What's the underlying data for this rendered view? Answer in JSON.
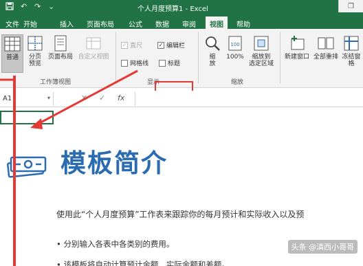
{
  "window": {
    "title": "个人月度预算1 - Excel",
    "restore_glyph": "❐"
  },
  "quick_access": {
    "undo_glyph": "↶",
    "redo_glyph": "↷",
    "more_glyph": "⌄"
  },
  "menu_tabs": [
    {
      "label": "文件"
    },
    {
      "label": "开始"
    },
    {
      "label": "插入"
    },
    {
      "label": "页面布局"
    },
    {
      "label": "公式"
    },
    {
      "label": "数据"
    },
    {
      "label": "审阅"
    },
    {
      "label": "视图"
    },
    {
      "label": "帮助"
    }
  ],
  "active_tab": "视图",
  "ribbon": {
    "workbook_views": {
      "group_label": "工作簿视图",
      "normal": "普通",
      "page_break": "分页\n预览",
      "page_layout": "页面布局",
      "custom_view": "自定义视图"
    },
    "show": {
      "group_label": "显示",
      "ruler": {
        "label": "直尺",
        "checked": true
      },
      "formula_bar": {
        "label": "编辑栏",
        "checked": true
      },
      "gridlines": {
        "label": "网格线",
        "checked": false
      },
      "headings": {
        "label": "标题",
        "checked": false
      }
    },
    "zoom": {
      "group_label": "缩放",
      "zoom": "缩\n放",
      "hundred": "100%",
      "zoom_to_selection": "缩放到\n选定区域"
    },
    "window": {
      "new_window": "新建窗口",
      "arrange_all": "全部重排",
      "freeze": "冻结窗\n格"
    }
  },
  "formula_bar": {
    "name_box": "A1",
    "cancel_glyph": "✕",
    "enter_glyph": "✓",
    "fx": "fx",
    "content": ""
  },
  "sheet": {
    "heading": "模板简介",
    "intro": "使用此“个人月度预算”工作表来跟踪你的每月预计和实际收入以及预",
    "bullets": [
      "• 分别输入各表中各类别的费用。",
      "• 该模板将自动计算预计金额、实际金额和差额。"
    ]
  },
  "watermark": "头条 @滇西小哥哥"
}
